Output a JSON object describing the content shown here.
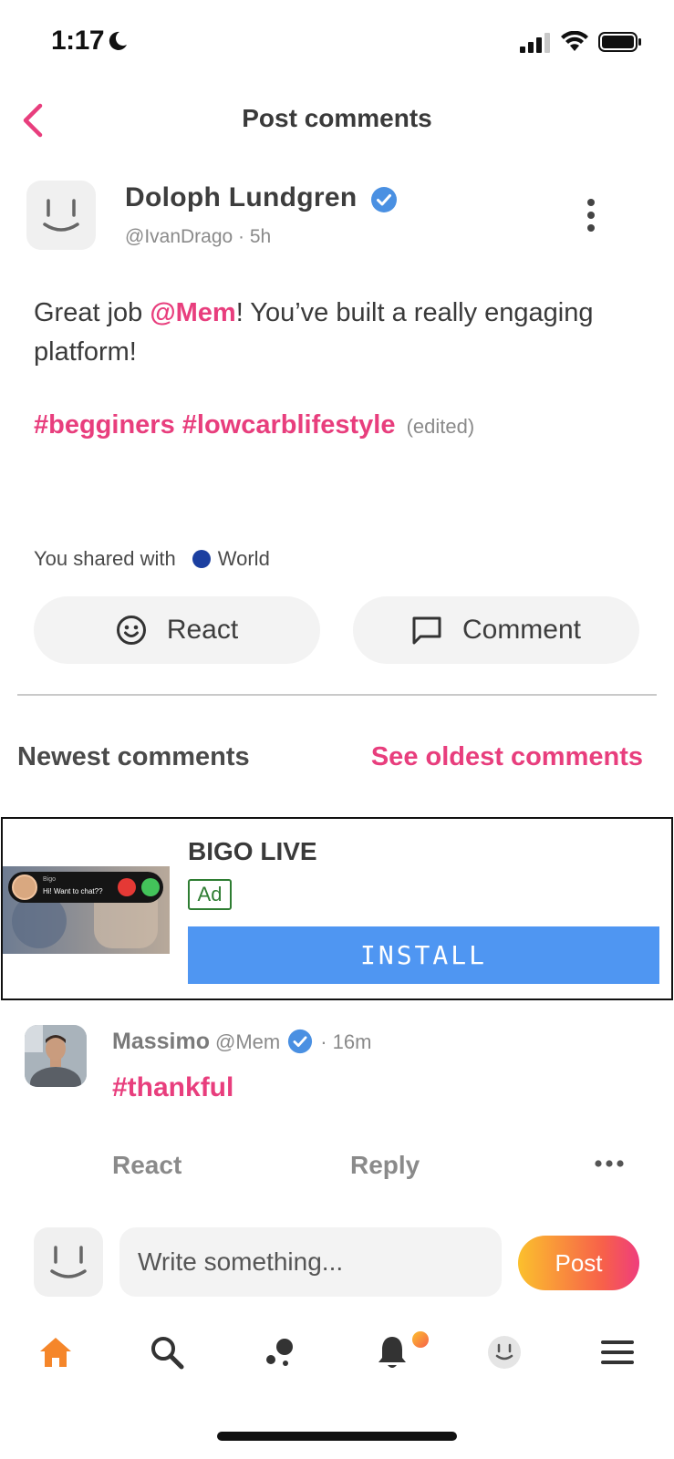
{
  "status_bar": {
    "time": "1:17"
  },
  "header": {
    "title": "Post comments"
  },
  "post": {
    "author_name": "Doloph Lundgren",
    "meta": "@IvanDrago · 5h",
    "text_before": "Great job ",
    "mention": "@Mem",
    "text_after": "! You’ve built a really engaging platform!",
    "hashtags": [
      "#begginers",
      "#lowcarblifestyle"
    ],
    "edited_label": "(edited)",
    "shared_label": "You shared with",
    "shared_audience": "World",
    "react_label": "React",
    "comment_label": "Comment"
  },
  "comments_section": {
    "newest_label": "Newest comments",
    "oldest_label": "See oldest comments"
  },
  "ad": {
    "caller_name": "Bigo",
    "caller_message": "Hi! Want to chat??",
    "title": "BIGO LIVE",
    "badge": "Ad",
    "install_label": "INSTALL"
  },
  "comment": {
    "name": "Massimo",
    "handle": "@Mem",
    "time": "· 16m",
    "tag": "#thankful",
    "react_label": "React",
    "reply_label": "Reply"
  },
  "composer": {
    "placeholder": "Write something...",
    "post_label": "Post"
  },
  "colors": {
    "accent_pink": "#e83e7d",
    "install_blue": "#4f96f2",
    "verified_blue": "#4a90e2",
    "nav_home_orange": "#f5862a"
  },
  "nav": {
    "items": [
      "home-icon",
      "search-icon",
      "community-icon",
      "bell-icon",
      "profile-icon",
      "menu-icon"
    ],
    "notifications_badge": true
  }
}
